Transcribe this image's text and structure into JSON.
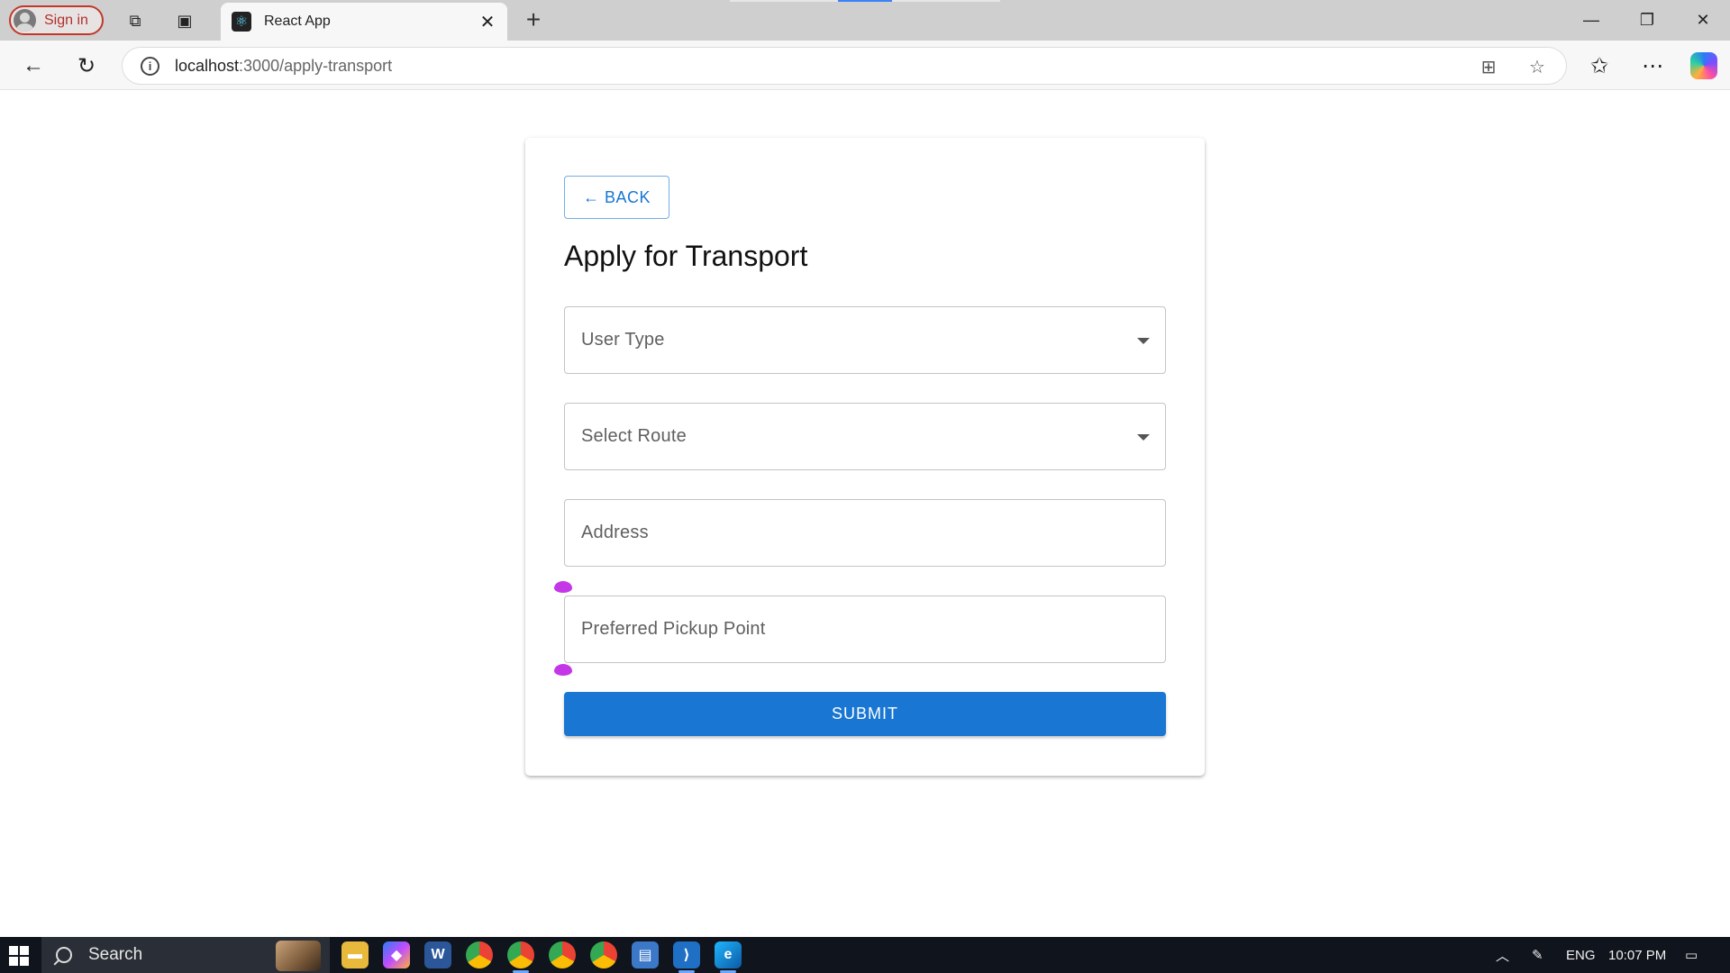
{
  "browser": {
    "profile_label": "Sign in",
    "tab_title": "React App",
    "url_host": "localhost",
    "url_path": ":3000/apply-transport"
  },
  "form": {
    "back_label": "← BACK",
    "title": "Apply for Transport",
    "user_type_label": "User Type",
    "route_label": "Select Route",
    "address_label": "Address",
    "pickup_label": "Preferred Pickup Point",
    "submit_label": "SUBMIT"
  },
  "taskbar": {
    "search_label": "Search",
    "language": "ENG",
    "time": "10:07 PM"
  },
  "colors": {
    "primary": "#1976d2",
    "handle": "#c437e8"
  }
}
